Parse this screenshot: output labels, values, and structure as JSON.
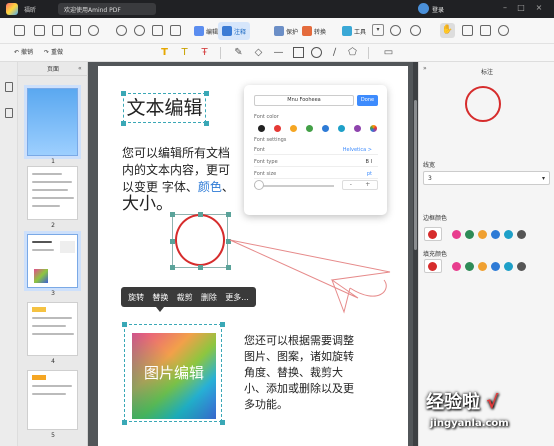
{
  "titlebar": {
    "app_name": "福昕",
    "tab_title": "欢迎使用Amind PDF",
    "login": "登录"
  },
  "toolbar": {
    "modes": [
      "编辑",
      "注释",
      "保护",
      "转换",
      "工具"
    ],
    "active_mode": "注释",
    "undo_label": "撤销",
    "redo_label": "重做"
  },
  "thumbnails": {
    "header": "页面",
    "pages": [
      "1",
      "2",
      "3",
      "4",
      "5"
    ],
    "selected": "3"
  },
  "content": {
    "title": "文本编辑",
    "para1_a": "您可以编辑所有文档内的文本内容，更可以变更",
    "para1_font": "字体",
    "para1_sep": "、",
    "para1_color": "颜色",
    "para1_sep2": "、",
    "para1_size": "大小。",
    "context_menu": [
      "旋转",
      "替换",
      "裁剪",
      "删除",
      "更多..."
    ],
    "image_label": "图片编辑",
    "para2": "您还可以根据需要调整图片、图案，诸如旋转角度、替换、裁剪大小、添加或删除以及更多功能。"
  },
  "font_panel": {
    "font_name": "Mnu Fooheea",
    "done": "Done",
    "font_color_label": "Font color",
    "font_settings_label": "Font settings",
    "rows": [
      {
        "key": "Font",
        "value": "Helvetica  >"
      },
      {
        "key": "Font type",
        "value": "B   I"
      },
      {
        "key": "Font size",
        "value": "pt"
      }
    ],
    "stepper": [
      "-",
      "+"
    ],
    "colors": [
      "#222222",
      "#e53935",
      "#f5a623",
      "#43a047",
      "#2e7bd6",
      "#1ea0c8",
      "#8e44ad",
      "#ff9800"
    ]
  },
  "properties": {
    "title": "标注",
    "width_label": "线宽",
    "width_value": "3",
    "border_color_label": "边框颜色",
    "fill_color_label": "填充颜色",
    "selected_color": "#d62c2c",
    "palette": [
      "#d62c2c",
      "#e83d8e",
      "#2e8b57",
      "#f0a030",
      "#2e7bd6",
      "#1ea0c8",
      "#555555"
    ]
  },
  "watermark": {
    "text": "经验啦",
    "check": "√",
    "url": "jingyanla.com"
  }
}
